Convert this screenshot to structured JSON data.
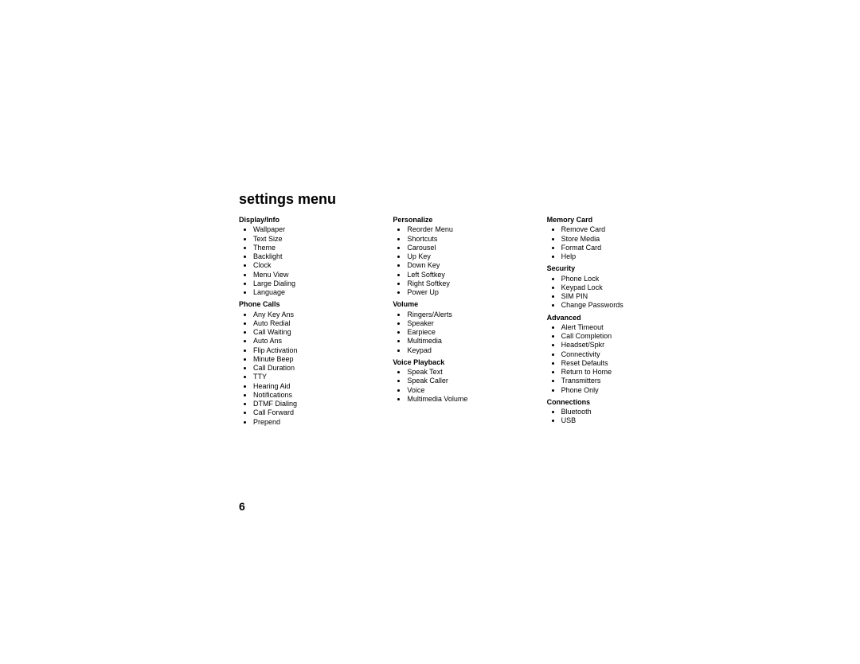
{
  "title": "settings menu",
  "page_number": "6",
  "columns": [
    {
      "sections": [
        {
          "title": "Display/Info",
          "items": [
            "Wallpaper",
            "Text Size",
            "Theme",
            "Backlight",
            "Clock",
            "Menu View",
            "Large Dialing",
            "Language"
          ]
        },
        {
          "title": "Phone Calls",
          "items": [
            "Any Key Ans",
            "Auto Redial",
            "Call Waiting",
            "Auto Ans",
            "Flip Activation",
            "Minute Beep",
            "Call Duration",
            "TTY",
            "Hearing Aid",
            "Notifications",
            "DTMF Dialing",
            "Call Forward",
            "Prepend"
          ]
        }
      ]
    },
    {
      "sections": [
        {
          "title": "Personalize",
          "items": [
            "Reorder Menu",
            "Shortcuts",
            "Carousel",
            "Up Key",
            "Down Key",
            "Left Softkey",
            "Right Softkey",
            "Power Up"
          ]
        },
        {
          "title": "Volume",
          "items": [
            "Ringers/Alerts",
            "Speaker",
            "Earpiece",
            "Multimedia",
            "Keypad"
          ]
        },
        {
          "title": "Voice Playback",
          "items": [
            "Speak Text",
            "Speak Caller",
            "Voice",
            "Multimedia Volume"
          ]
        }
      ]
    },
    {
      "sections": [
        {
          "title": "Memory Card",
          "items": [
            "Remove Card",
            "Store Media",
            "Format Card",
            "Help"
          ]
        },
        {
          "title": "Security",
          "items": [
            "Phone Lock",
            "Keypad Lock",
            "SIM PIN",
            "Change Passwords"
          ]
        },
        {
          "title": "Advanced",
          "items": [
            "Alert Timeout",
            "Call Completion",
            "Headset/Spkr",
            "Connectivity",
            "Reset Defaults",
            "Return to Home",
            "Transmitters",
            "Phone Only"
          ]
        },
        {
          "title": "Connections",
          "items": [
            "Bluetooth",
            "USB"
          ]
        }
      ]
    }
  ]
}
